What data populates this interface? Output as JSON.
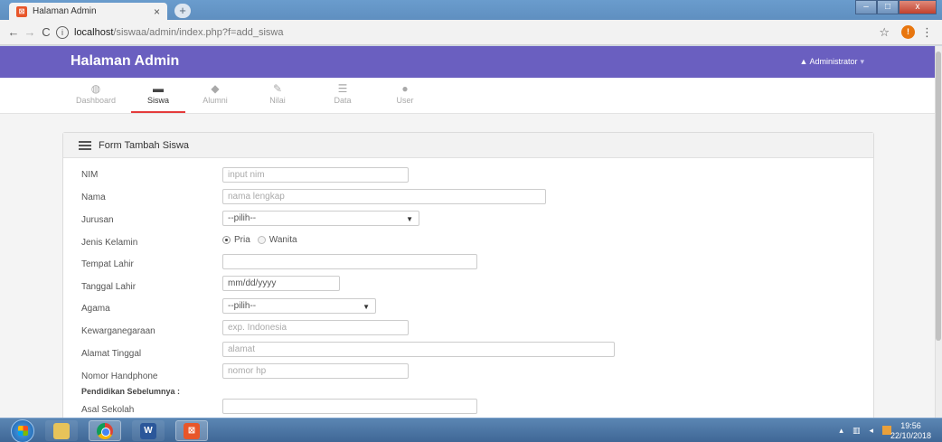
{
  "browser": {
    "tab_title": "Halaman Admin",
    "tab_close": "×",
    "tab_favicon": "xampp-icon",
    "new_tab": "+",
    "url_host": "localhost",
    "url_path": "/siswaa/admin/index.php?f=add_siswa",
    "win_minimize": "–",
    "win_maximize": "□",
    "win_close": "x",
    "back": "←",
    "forward": "→",
    "reload": "C",
    "info": "i",
    "star": "☆",
    "ext_badge": "!",
    "menu": "⋮"
  },
  "app": {
    "brand": "Halaman Admin",
    "user_menu": "Administrator",
    "user_icon": "user-icon",
    "accent": "#6a5fc0"
  },
  "nav": {
    "items": [
      {
        "label": "Dashboard",
        "icon": "dashboard-icon"
      },
      {
        "label": "Siswa",
        "icon": "briefcase-icon",
        "active": true
      },
      {
        "label": "Alumni",
        "icon": "tag-icon"
      },
      {
        "label": "Nilai",
        "icon": "edit-icon"
      },
      {
        "label": "Data",
        "icon": "list-icon"
      },
      {
        "label": "User",
        "icon": "user-icon"
      }
    ]
  },
  "form": {
    "title": "Form Tambah Siswa",
    "fields": {
      "nim": {
        "label": "NIM",
        "placeholder": "input nim"
      },
      "nama": {
        "label": "Nama",
        "placeholder": "nama lengkap"
      },
      "jurusan": {
        "label": "Jurusan",
        "value": "--pilih--"
      },
      "jenis_kelamin": {
        "label": "Jenis Kelamin",
        "options": [
          "Pria",
          "Wanita"
        ],
        "selected": "Pria"
      },
      "tempat_lahir": {
        "label": "Tempat Lahir",
        "placeholder": ""
      },
      "tanggal_lahir": {
        "label": "Tanggal Lahir",
        "value": "mm/dd/yyyy"
      },
      "agama": {
        "label": "Agama",
        "value": "--pilih--"
      },
      "kewarganegaraan": {
        "label": "Kewarganegaraan",
        "placeholder": "exp. Indonesia"
      },
      "alamat": {
        "label": "Alamat Tinggal",
        "placeholder": "alamat"
      },
      "hp": {
        "label": "Nomor Handphone",
        "placeholder": "nomor hp"
      },
      "section_pendidikan": "Pendidikan Sebelumnya :",
      "asal_sekolah": {
        "label": "Asal Sekolah",
        "placeholder": ""
      }
    }
  },
  "taskbar": {
    "apps": [
      {
        "name": "explorer",
        "icon": "folder-icon"
      },
      {
        "name": "chrome",
        "icon": "chrome-icon"
      },
      {
        "name": "word",
        "icon": "word-icon",
        "glyph": "W"
      },
      {
        "name": "xampp",
        "icon": "xampp-icon",
        "glyph": "⊠"
      }
    ],
    "time": "19:56",
    "date": "22/10/2018"
  }
}
